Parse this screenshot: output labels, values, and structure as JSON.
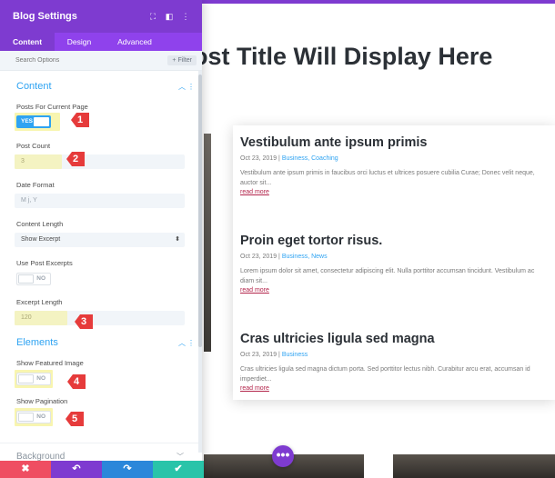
{
  "page": {
    "title": "ost Title Will Display Here",
    "posts": [
      {
        "title": "Vestibulum ante ipsum primis",
        "date": "Oct 23, 2019",
        "sep": " | ",
        "categories": "Business, Coaching",
        "excerpt": "Vestibulum ante ipsum primis in faucibus orci luctus et ultrices posuere cubilia Curae; Donec velit neque, auctor sit...",
        "more": "read more"
      },
      {
        "title": "Proin eget tortor risus.",
        "date": "Oct 23, 2019",
        "sep": " | ",
        "categories": "Business, News",
        "excerpt": "Lorem ipsum dolor sit amet, consectetur adipiscing elit. Nulla porttitor accumsan tincidunt. Vestibulum ac diam sit...",
        "more": "read more"
      },
      {
        "title": "Cras ultricies ligula sed magna",
        "date": "Oct 23, 2019",
        "sep": " | ",
        "categories": "Business",
        "excerpt": "Cras ultricies ligula sed magna dictum porta. Sed porttitor lectus nibh. Curabitur arcu erat, accumsan id imperdiet...",
        "more": "read more"
      }
    ],
    "add_button": "•••"
  },
  "panel": {
    "title": "Blog Settings",
    "header_icons": [
      "expand-icon",
      "sidebar-icon",
      "more-vertical-icon"
    ],
    "tabs": [
      "Content",
      "Design",
      "Advanced"
    ],
    "active_tab": "Content",
    "search_placeholder": "Search Options",
    "filter_label": "+ Filter",
    "content_section": {
      "title": "Content",
      "posts_for_current_page": {
        "label": "Posts For Current Page",
        "value": "YES"
      },
      "post_count": {
        "label": "Post Count",
        "value": "3"
      },
      "date_format": {
        "label": "Date Format",
        "placeholder": "M j, Y"
      },
      "content_length": {
        "label": "Content Length",
        "value": "Show Excerpt"
      },
      "use_post_excerpts": {
        "label": "Use Post Excerpts",
        "value": "NO"
      },
      "excerpt_length": {
        "label": "Excerpt Length",
        "value": "120"
      }
    },
    "elements_section": {
      "title": "Elements",
      "show_featured_image": {
        "label": "Show Featured Image",
        "value": "NO"
      },
      "show_pagination": {
        "label": "Show Pagination",
        "value": "NO"
      }
    },
    "collapsed_section": "Background",
    "actions": [
      {
        "name": "cancel",
        "icon": "✖",
        "color": "#ef4e62"
      },
      {
        "name": "undo",
        "icon": "↶",
        "color": "#7e3bd0"
      },
      {
        "name": "redo",
        "icon": "↷",
        "color": "#2b87da"
      },
      {
        "name": "save",
        "icon": "✔",
        "color": "#29c4a9"
      }
    ]
  },
  "markers": [
    "1",
    "2",
    "3",
    "4",
    "5"
  ],
  "colors": {
    "accent": "#7e3bd0",
    "blue": "#2ea3f2",
    "marker": "#e63b3b",
    "highlight": "#f5f196"
  }
}
